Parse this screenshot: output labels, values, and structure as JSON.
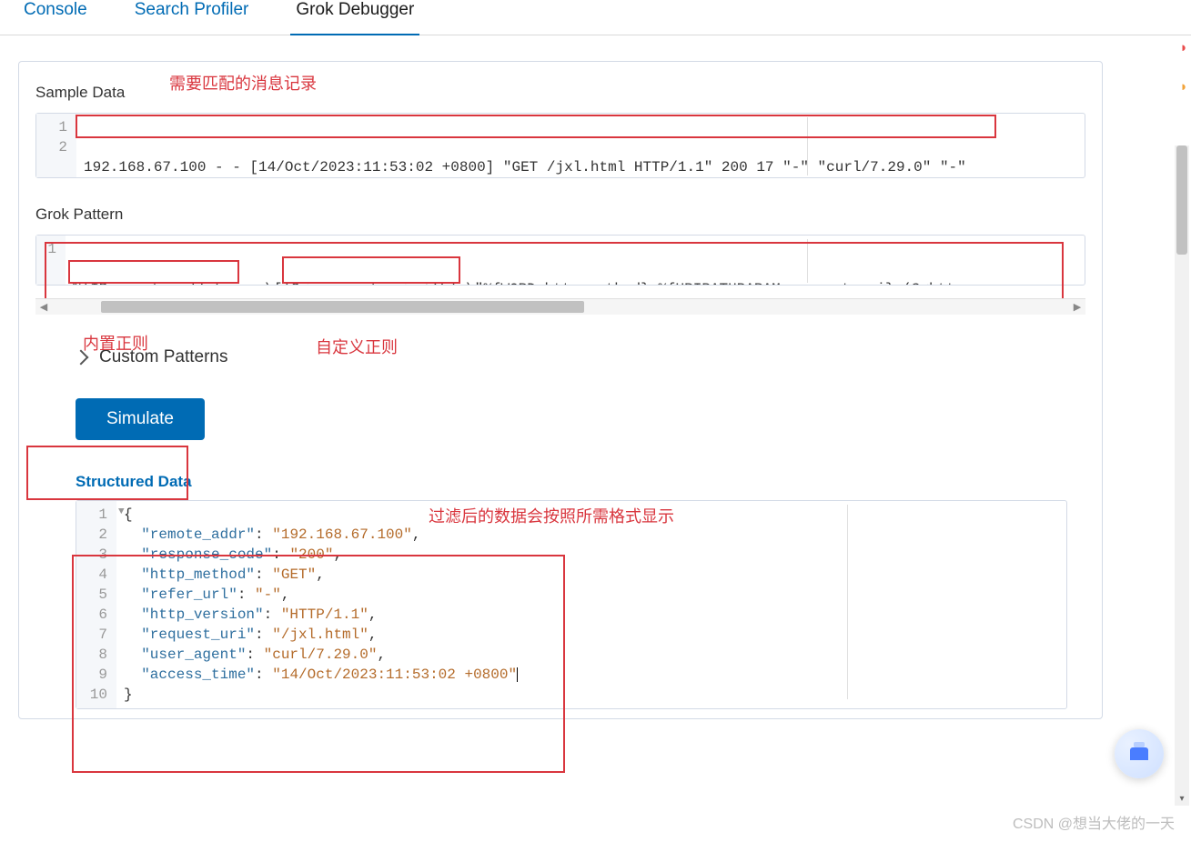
{
  "tabs": {
    "console": "Console",
    "search_profiler": "Search Profiler",
    "grok_debugger": "Grok Debugger"
  },
  "panel": {
    "sample_data_label": "Sample Data",
    "sample_data_line1": "192.168.67.100 - - [14/Oct/2023:11:53:02 +0800] \"GET /jxl.html HTTP/1.1\" 200 17 \"-\" \"curl/7.29.0\" \"-\"",
    "grok_pattern_label": "Grok Pattern",
    "grok_pattern_line1": "%{IP:remote_addr} - - \\[(?<access_time>.+)\\] \\\"%{WORD:http_method} %{URIPATHPARAM:request_uri} (?<http_vers",
    "custom_patterns_label": "Custom Patterns",
    "simulate_label": "Simulate",
    "structured_label": "Structured Data"
  },
  "gutters": {
    "sample": [
      "1",
      "2"
    ],
    "pattern": [
      "1"
    ],
    "structured": [
      "1",
      "2",
      "3",
      "4",
      "5",
      "6",
      "7",
      "8",
      "9",
      "10"
    ]
  },
  "structured_lines": [
    {
      "indent": 0,
      "type": "brace",
      "text": "{"
    },
    {
      "indent": 1,
      "key": "remote_addr",
      "val": "192.168.67.100",
      "comma": true
    },
    {
      "indent": 1,
      "key": "response_code",
      "val": "200",
      "comma": true
    },
    {
      "indent": 1,
      "key": "http_method",
      "val": "GET",
      "comma": true
    },
    {
      "indent": 1,
      "key": "refer_url",
      "val": "-",
      "comma": true
    },
    {
      "indent": 1,
      "key": "http_version",
      "val": "HTTP/1.1",
      "comma": true
    },
    {
      "indent": 1,
      "key": "request_uri",
      "val": "/jxl.html",
      "comma": true
    },
    {
      "indent": 1,
      "key": "user_agent",
      "val": "curl/7.29.0",
      "comma": true
    },
    {
      "indent": 1,
      "key": "access_time",
      "val": "14/Oct/2023:11:53:02 +0800",
      "comma": false,
      "cursor": true
    },
    {
      "indent": 0,
      "type": "brace",
      "text": "}"
    }
  ],
  "annotations": {
    "anno1": "需要匹配的消息记录",
    "anno2": "内置正则",
    "anno3": "自定义正则",
    "anno4": "过滤后的数据会按照所需格式显示"
  },
  "watermark": "CSDN @想当大佬的一天"
}
